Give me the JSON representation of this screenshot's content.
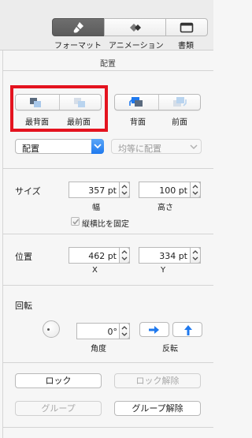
{
  "toolbar": {
    "format_label": "フォーマット",
    "animation_label": "アニメーション",
    "document_label": "書類"
  },
  "panel": {
    "header": "配置"
  },
  "arrange": {
    "back_most": "最背面",
    "front_most": "最前面",
    "back": "背面",
    "front": "前面"
  },
  "align": {
    "align_label": "配置",
    "distribute_label": "均等に配置"
  },
  "size": {
    "section": "サイズ",
    "width_value": "357 pt",
    "height_value": "100 pt",
    "width_label": "幅",
    "height_label": "高さ",
    "constrain_label": "縦横比を固定",
    "constrain_checked": true
  },
  "position": {
    "section": "位置",
    "x_value": "462 pt",
    "y_value": "334 pt",
    "x_label": "X",
    "y_label": "Y"
  },
  "rotate": {
    "section": "回転",
    "angle_value": "0°",
    "angle_label": "角度",
    "flip_label": "反転"
  },
  "lock": {
    "lock_label": "ロック",
    "unlock_label": "ロック解除"
  },
  "group": {
    "group_label": "グループ",
    "ungroup_label": "グループ解除"
  },
  "colors": {
    "highlight": "#e4131f",
    "accent_blue": "#1f79ee"
  }
}
